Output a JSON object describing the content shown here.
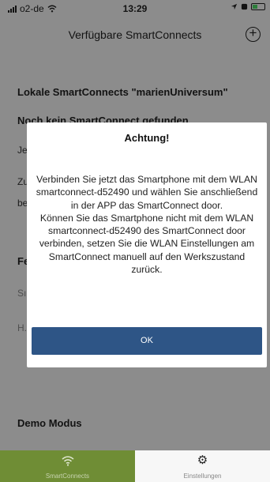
{
  "status_bar": {
    "carrier": "o2-de",
    "time": "13:29"
  },
  "navbar": {
    "title": "Verfügbare SmartConnects",
    "add_icon": "plus-circle-icon"
  },
  "background": {
    "section_local": "Lokale SmartConnects \"marienUniversum\"",
    "none_found": "Noch kein SmartConnect gefunden",
    "line_1": "Je",
    "line_2": "Zu",
    "line_3": "be",
    "section_fe": "Fe",
    "row_s": "Sı",
    "row_h": "H.",
    "demo_mode": "Demo Modus"
  },
  "dialog": {
    "title": "Achtung!",
    "message_1": "Verbinden Sie jetzt das Smartphone mit dem WLAN smartconnect-d52490 und wählen Sie anschließend in der APP das SmartConnect door.",
    "message_2": "Können Sie das Smartphone nicht mit dem WLAN smartconnect-d52490 des SmartConnect door verbinden, setzen Sie die WLAN Einstellungen am SmartConnect manuell auf den Werkszustand zurück.",
    "ok_label": "OK"
  },
  "tabbar": {
    "tab_smartconnects": "SmartConnects",
    "tab_settings": "Einstellungen",
    "active_color": "#6f8d35"
  },
  "colors": {
    "primary_button": "#2e5586"
  }
}
